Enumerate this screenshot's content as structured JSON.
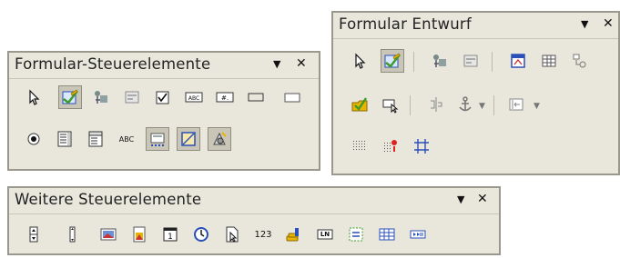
{
  "toolbars": {
    "form_controls": {
      "title": "Formular-Steuerelemente",
      "menu_glyph": "▼",
      "close_glyph": "✕",
      "items": [
        "select",
        "design-mode",
        "wizards",
        "control-properties",
        "check-box",
        "text-box",
        "formatted-field",
        "push-button",
        "option-button",
        "list-box",
        "combo-box",
        "label-field",
        "form-navigator",
        "form-design",
        "more-controls"
      ],
      "abc_label": "ABC"
    },
    "form_design": {
      "title": "Formular Entwurf",
      "menu_glyph": "▼",
      "close_glyph": "✕",
      "items": [
        "select",
        "design-mode",
        "control-properties",
        "form-properties",
        "form-navigator",
        "add-field",
        "activation-order",
        "open-in-design-mode",
        "auto-control-focus",
        "position-size",
        "anchor",
        "alignment",
        "display-grid",
        "snap-to-grid",
        "guides-when-moving"
      ]
    },
    "more_controls": {
      "title": "Weitere Steuerelemente",
      "menu_glyph": "▼",
      "close_glyph": "✕",
      "items": [
        "spin-button",
        "scrollbar",
        "image-button",
        "image-control",
        "date-field",
        "time-field",
        "file-selection",
        "numeric-field",
        "currency-field",
        "pattern-field",
        "group-box",
        "table-control",
        "navigation-bar"
      ],
      "numeric_label": "123",
      "pattern_label": "LN"
    }
  },
  "colors": {
    "toolbar_bg": "#e9e7dc",
    "toolbar_border": "#9a988c",
    "active_bg": "#c9c6b8",
    "icon_blue": "#2a4fb8",
    "icon_green": "#3e9a2a",
    "icon_yellow": "#e8b400"
  }
}
